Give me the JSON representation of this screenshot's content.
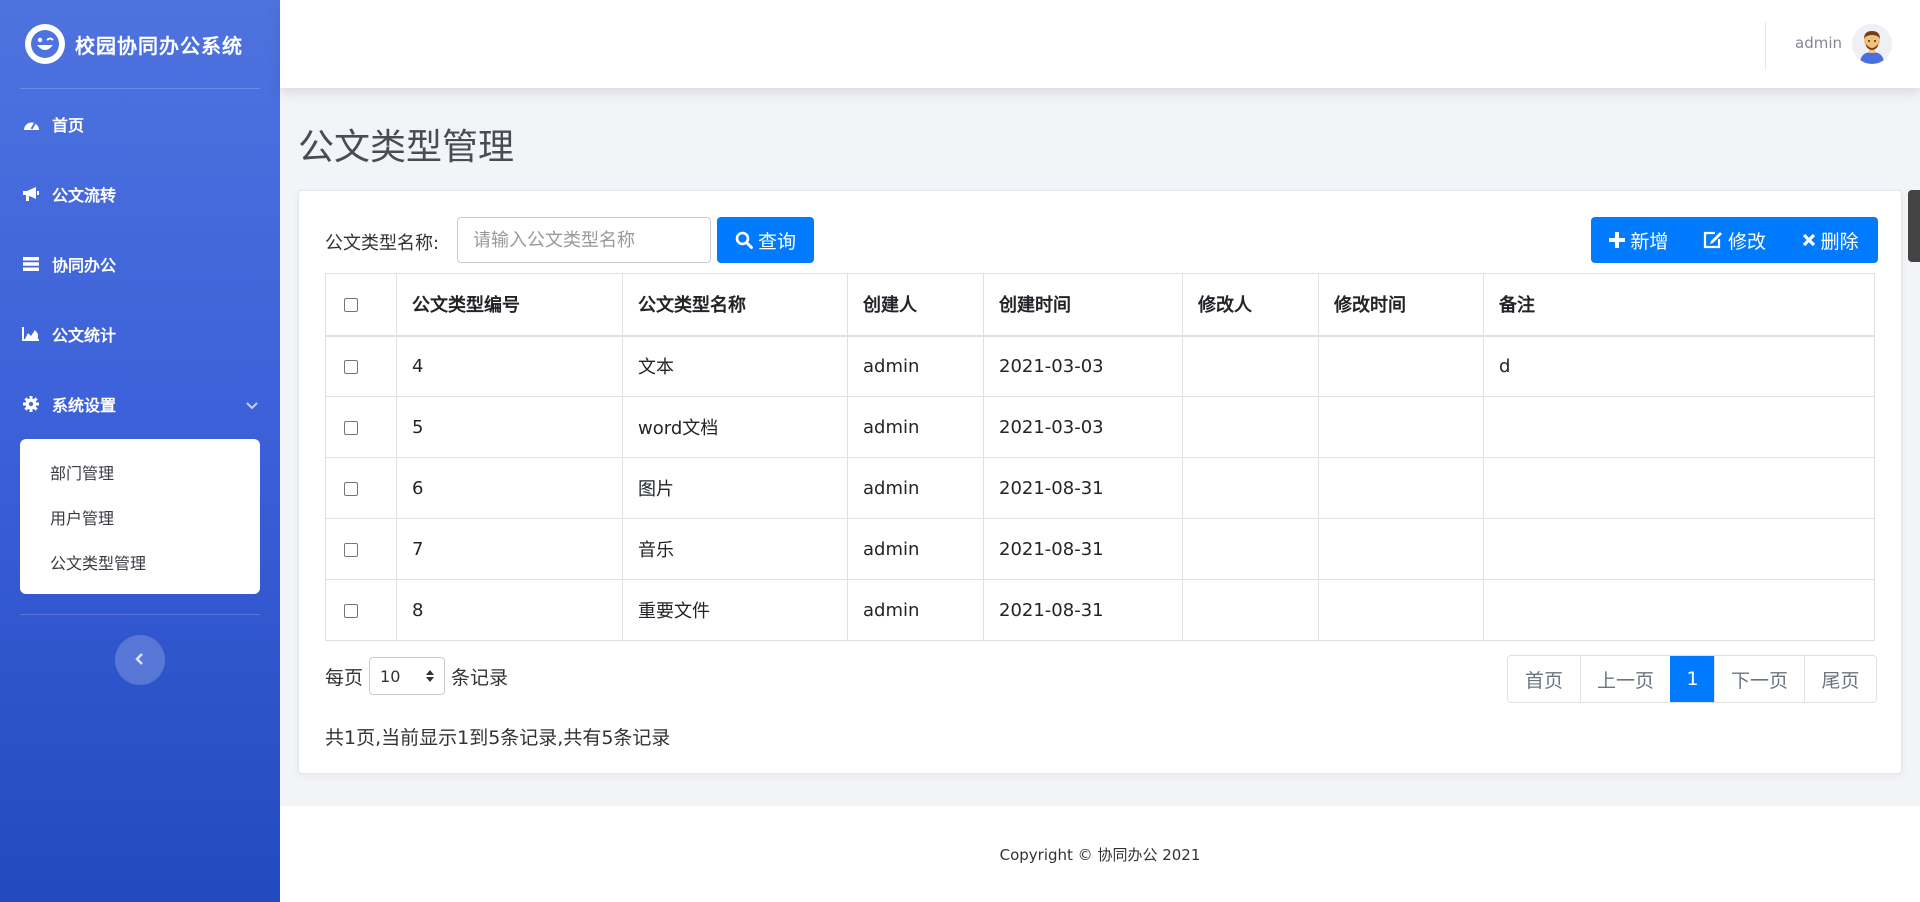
{
  "app": {
    "title": "校园协同办公系统"
  },
  "sidebar": {
    "items": [
      {
        "label": "首页",
        "icon": "dashboard-icon"
      },
      {
        "label": "公文流转",
        "icon": "bullhorn-icon"
      },
      {
        "label": "协同办公",
        "icon": "stack-icon"
      },
      {
        "label": "公文统计",
        "icon": "area-chart-icon"
      },
      {
        "label": "系统设置",
        "icon": "gear-icon",
        "expanded": true
      }
    ],
    "submenu": [
      "部门管理",
      "用户管理",
      "公文类型管理"
    ],
    "collapse_icon": "chevron-left-icon"
  },
  "topbar": {
    "user": "admin",
    "avatar_icon": "user-avatar"
  },
  "page": {
    "title": "公文类型管理"
  },
  "search": {
    "label": "公文类型名称:",
    "placeholder": "请输入公文类型名称",
    "value": "",
    "button": "查询"
  },
  "actions": {
    "add": "新增",
    "edit": "修改",
    "delete": "删除"
  },
  "table": {
    "headers": [
      "公文类型编号",
      "公文类型名称",
      "创建人",
      "创建时间",
      "修改人",
      "修改时间",
      "备注"
    ],
    "rows": [
      [
        "4",
        "文本",
        "admin",
        "2021-03-03",
        "",
        "",
        "d"
      ],
      [
        "5",
        "word文档",
        "admin",
        "2021-03-03",
        "",
        "",
        ""
      ],
      [
        "6",
        "图片",
        "admin",
        "2021-08-31",
        "",
        "",
        ""
      ],
      [
        "7",
        "音乐",
        "admin",
        "2021-08-31",
        "",
        "",
        ""
      ],
      [
        "8",
        "重要文件",
        "admin",
        "2021-08-31",
        "",
        "",
        ""
      ]
    ]
  },
  "pagination": {
    "per_page_prefix": "每页",
    "per_page_value": "10",
    "per_page_suffix": "条记录",
    "first": "首页",
    "prev": "上一页",
    "current": "1",
    "next": "下一页",
    "last": "尾页",
    "summary": "共1页,当前显示1到5条记录,共有5条记录"
  },
  "footer": {
    "copyright": "Copyright © 协同办公 2021"
  },
  "colors": {
    "primary": "#007bff",
    "sidebar_top": "#4e73df",
    "sidebar_bottom": "#224abe"
  }
}
